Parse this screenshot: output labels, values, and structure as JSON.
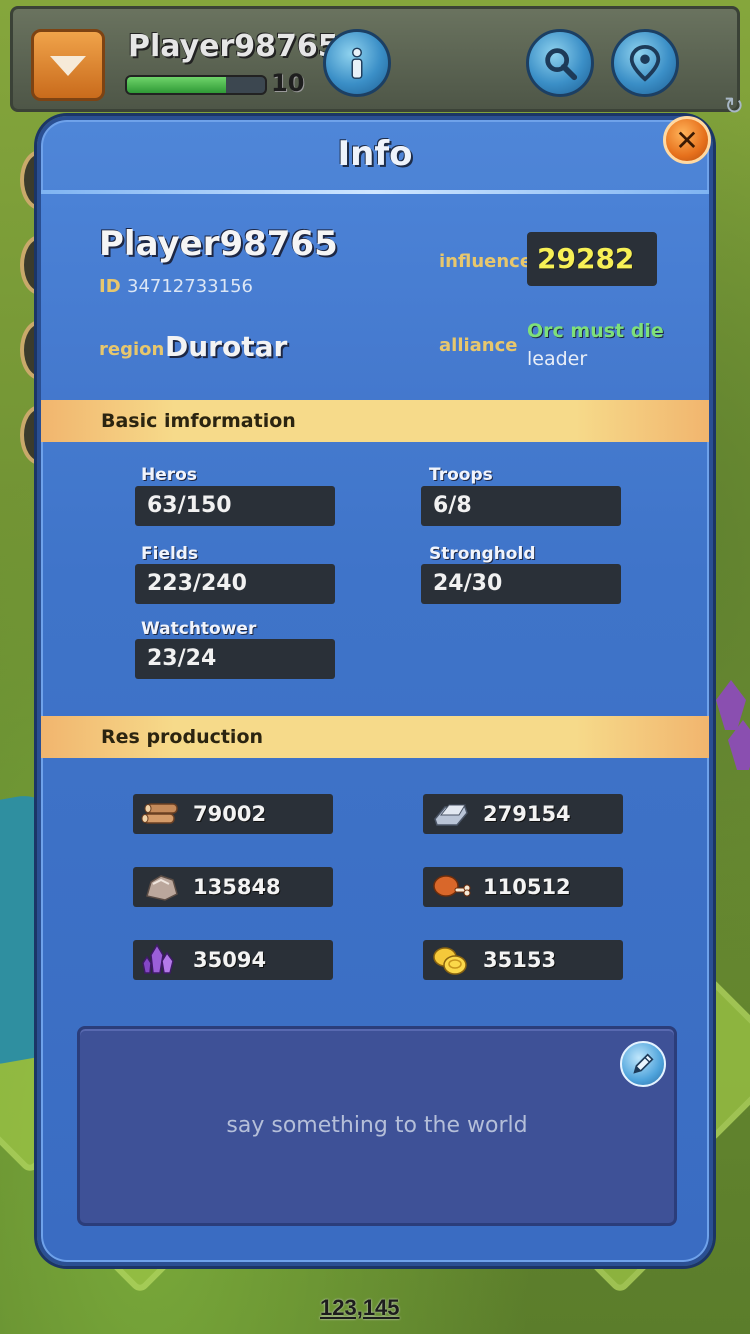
{
  "topbar": {
    "player_name": "Player98765",
    "level": "10",
    "xp_progress": 0.72
  },
  "info": {
    "title": "Info",
    "player_name": "Player98765",
    "id_label": "ID",
    "id_value": "34712733156",
    "influence_label": "influence",
    "influence_value": "29282",
    "region_label": "region",
    "region_value": "Durotar",
    "alliance_label": "alliance",
    "alliance_name": "Orc must die",
    "alliance_role": "leader"
  },
  "basic": {
    "header": "Basic imformation",
    "stats": [
      {
        "label": "Heros",
        "value": "63/150"
      },
      {
        "label": "Troops",
        "value": "6/8"
      },
      {
        "label": "Fields",
        "value": "223/240"
      },
      {
        "label": "Stronghold",
        "value": "24/30"
      },
      {
        "label": "Watchtower",
        "value": "23/24"
      }
    ]
  },
  "resources": {
    "header": "Res  production",
    "items": [
      {
        "icon": "wood-icon",
        "value": "79002"
      },
      {
        "icon": "iron-icon",
        "value": "279154"
      },
      {
        "icon": "stone-icon",
        "value": "135848"
      },
      {
        "icon": "food-icon",
        "value": "110512"
      },
      {
        "icon": "crystal-icon",
        "value": "35094"
      },
      {
        "icon": "gold-icon",
        "value": "35153"
      }
    ]
  },
  "message": {
    "placeholder": "say something to the world"
  },
  "map": {
    "coordinates": "123,145"
  },
  "colors": {
    "panel_blue": "#4178cc",
    "header_gold": "#f6da8a",
    "influence_yellow": "#f7f056",
    "alliance_green": "#7ee07a",
    "label_gold": "#e7c76d"
  }
}
